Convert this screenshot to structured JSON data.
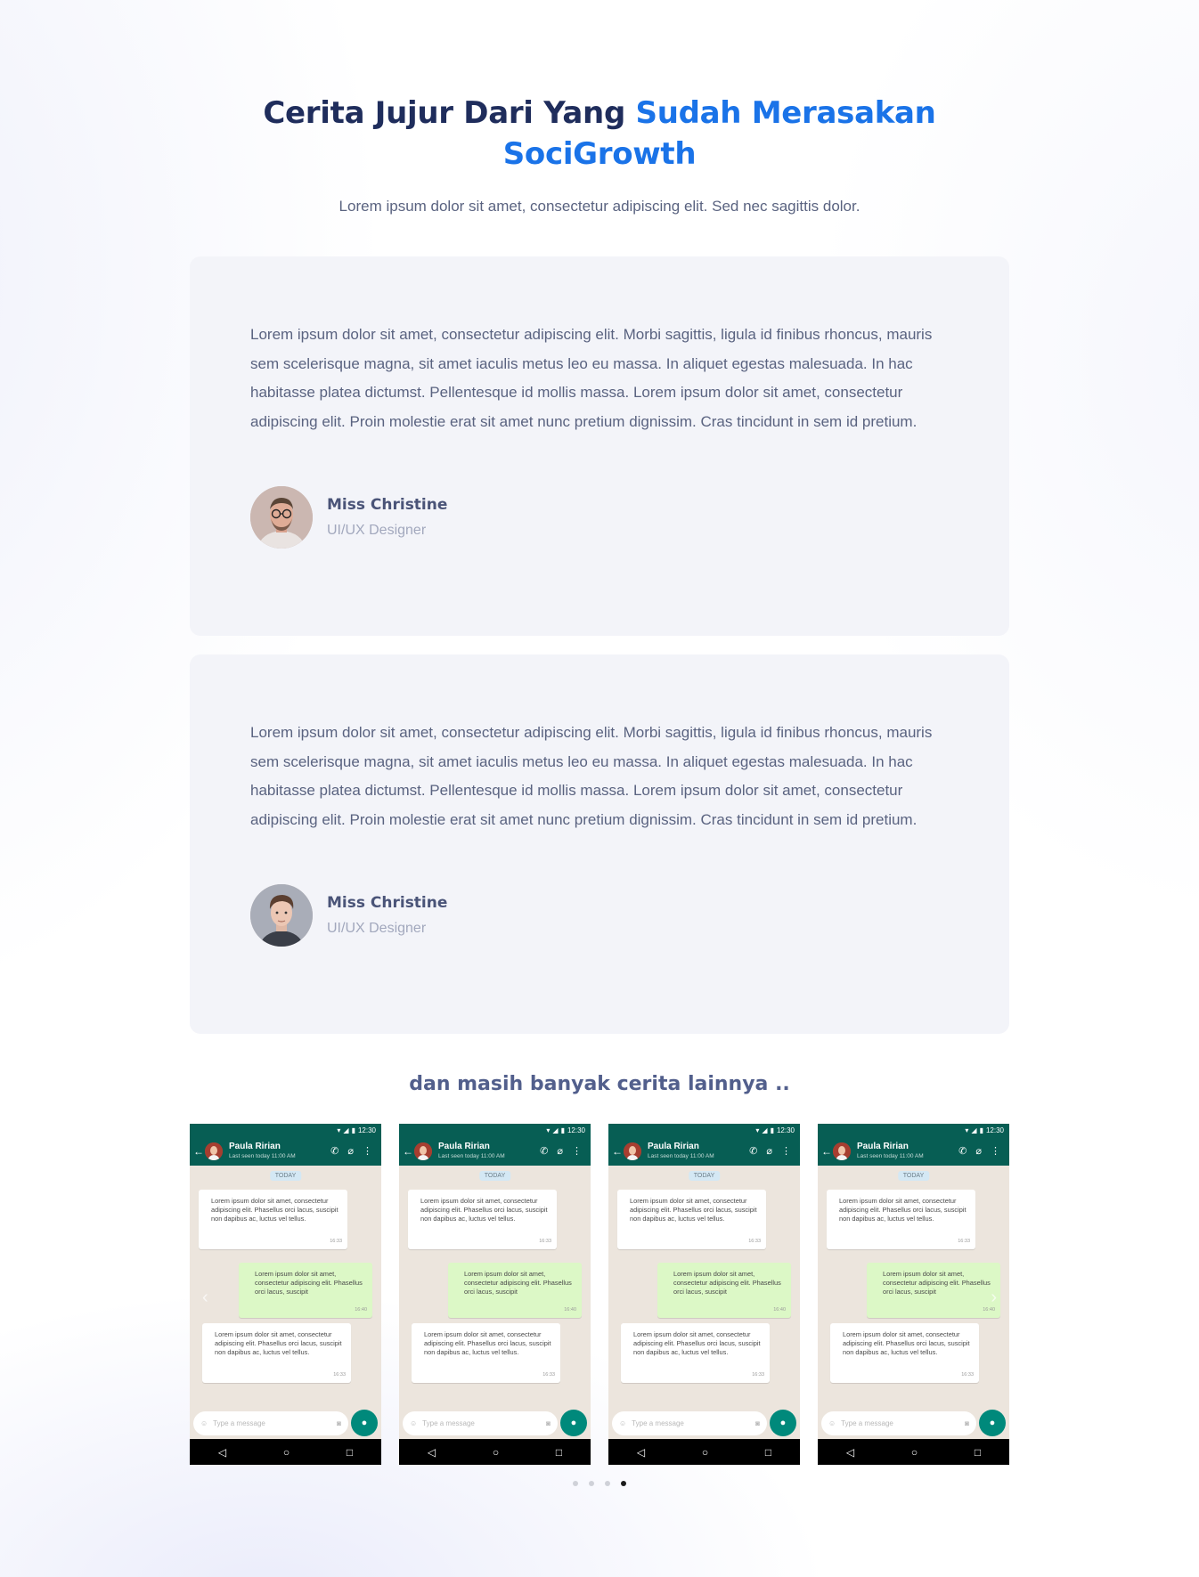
{
  "heading": {
    "part1": "Cerita Jujur Dari Yang ",
    "accent": "Sudah Merasakan SociGrowth"
  },
  "subtitle": "Lorem ipsum dolor sit amet, consectetur adipiscing elit. Sed nec sagittis dolor.",
  "testimonials": [
    {
      "quote": "Lorem ipsum dolor sit amet, consectetur adipiscing elit. Morbi sagittis, ligula id finibus rhoncus, mauris sem scelerisque magna, sit amet iaculis metus leo eu massa. In aliquet egestas malesuada. In hac habitasse platea dictumst. Pellentesque id mollis massa. Lorem ipsum dolor sit amet, consectetur adipiscing elit. Proin molestie erat sit amet nunc pretium dignissim. Cras tincidunt in sem id pretium.",
      "name": "Miss Christine",
      "role": "UI/UX Designer"
    },
    {
      "quote": "Lorem ipsum dolor sit amet, consectetur adipiscing elit. Morbi sagittis, ligula id finibus rhoncus, mauris sem scelerisque magna, sit amet iaculis metus leo eu massa. In aliquet egestas malesuada. In hac habitasse platea dictumst. Pellentesque id mollis massa. Lorem ipsum dolor sit amet, consectetur adipiscing elit. Proin molestie erat sit amet nunc pretium dignissim. Cras tincidunt in sem id pretium.",
      "name": "Miss Christine",
      "role": "UI/UX Designer"
    }
  ],
  "more_title": "dan masih banyak cerita lainnya ..",
  "chat": {
    "status_time": "12:30",
    "contact_name": "Paula Ririan",
    "last_seen": "Last seen today 11:00 AM",
    "today": "TODAY",
    "msg_in_1": "Lorem ipsum dolor sit amet, consectetur adipiscing elit. Phasellus orci lacus, suscipit non dapibus ac, luctus vel tellus.",
    "msg_in_1_time": "16:33",
    "msg_out": "Lorem ipsum dolor sit amet, consectetur adipiscing elit. Phasellus orci lacus, suscipit",
    "msg_out_time": "16:40",
    "msg_in_2": "Lorem ipsum dolor sit amet, consectetur adipiscing elit. Phasellus orci lacus, suscipit non dapibus ac, luctus vel tellus.",
    "msg_in_2_time": "16:33",
    "input_placeholder": "Type a message"
  },
  "carousel": {
    "slides": 4,
    "active_dot": 4
  },
  "colors": {
    "heading": "#1f2d5c",
    "accent": "#1a73e8",
    "card_bg": "#f3f4f9",
    "whatsapp_green": "#075e54"
  }
}
